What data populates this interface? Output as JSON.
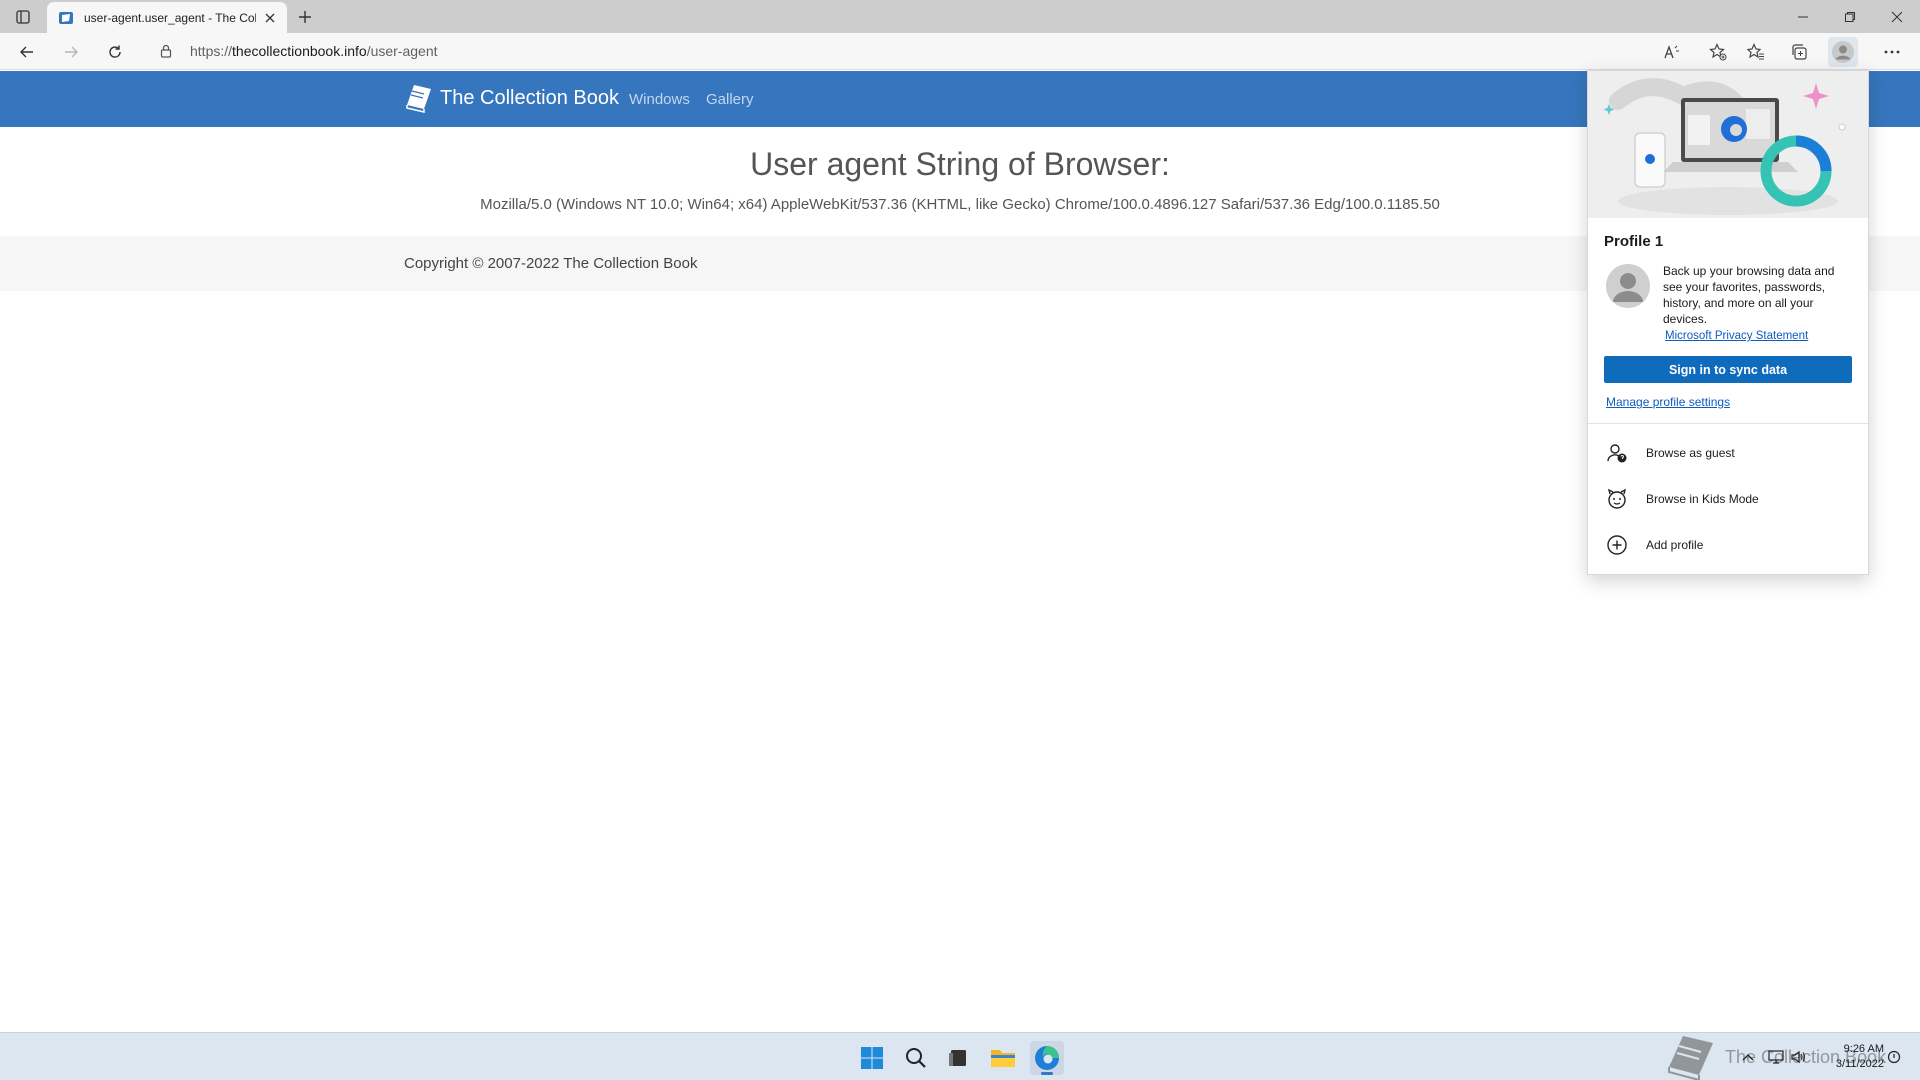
{
  "browser": {
    "tab": {
      "title": "user-agent.user_agent - The Collection Book"
    },
    "address_bar": {
      "url_prefix": "https://",
      "url_host": "thecollectionbook.info",
      "url_path": "/user-agent"
    }
  },
  "page": {
    "header": {
      "brand": "The Collection Book",
      "nav": [
        "Windows",
        "Gallery"
      ]
    },
    "heading": "User agent String of Browser:",
    "user_agent": "Mozilla/5.0 (Windows NT 10.0; Win64; x64) AppleWebKit/537.36 (KHTML, like Gecko) Chrome/100.0.4896.127 Safari/537.36 Edg/100.0.1185.50",
    "footer": {
      "copyright": "Copyright © 2007-2022 The Collection Book"
    }
  },
  "profile_flyout": {
    "profile_name": "Profile 1",
    "sync_description": "Back up your browsing data and see your favorites, passwords, history, and more on all your devices.",
    "privacy_link": "Microsoft Privacy Statement",
    "sign_in_button": "Sign in to sync data",
    "manage_link": "Manage profile settings",
    "menu": [
      {
        "label": "Browse as guest",
        "icon": "guest-icon"
      },
      {
        "label": "Browse in Kids Mode",
        "icon": "kids-mode-icon"
      },
      {
        "label": "Add profile",
        "icon": "add-circle-icon"
      }
    ]
  },
  "taskbar": {
    "clock": {
      "time": "9:26 AM",
      "date": "3/11/2022"
    },
    "watermark": "The Collection Book"
  },
  "colors": {
    "site_header": "#3676be",
    "sign_in_button": "#0f6cbd",
    "link": "#0f5bbf"
  }
}
